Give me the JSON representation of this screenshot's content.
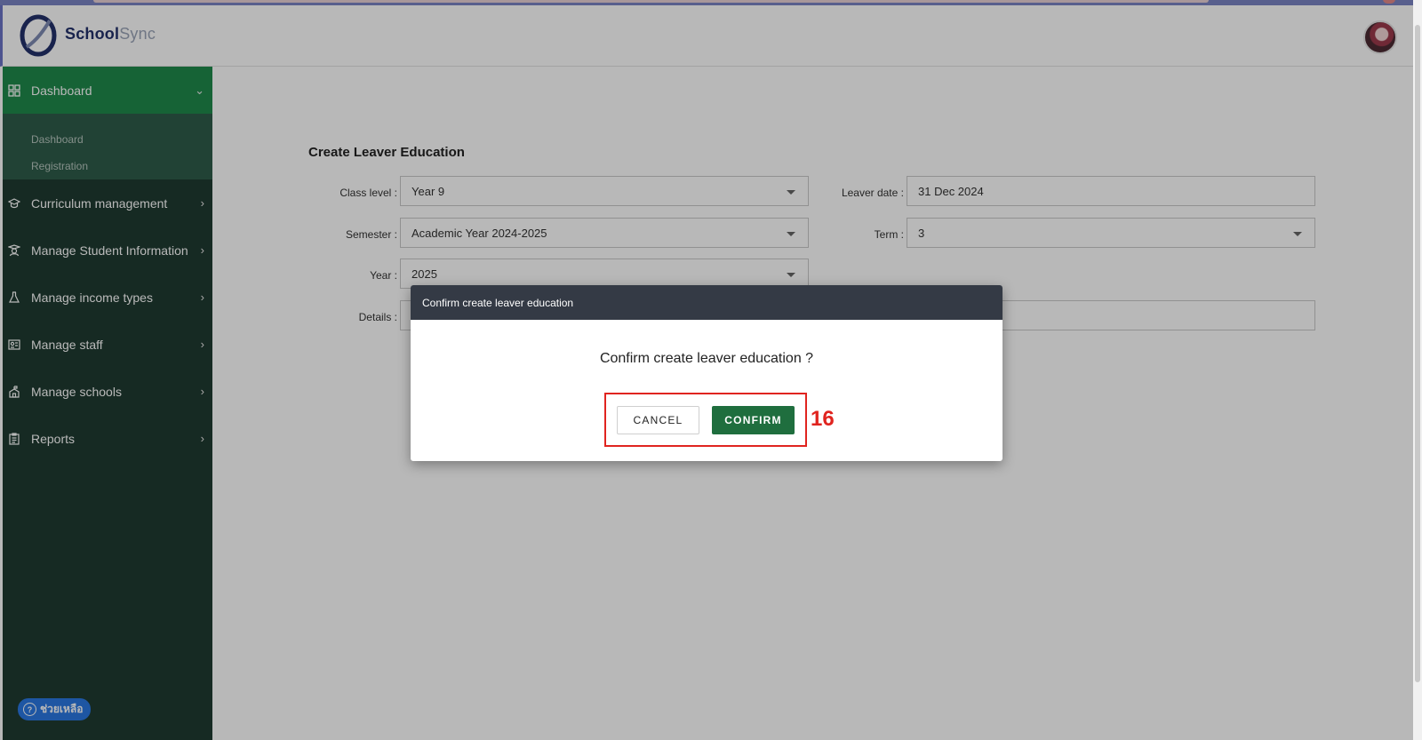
{
  "app": {
    "name_part1": "School",
    "name_part2": "Sync"
  },
  "sidebar": {
    "items": [
      {
        "label": "Dashboard",
        "icon": "grid-icon",
        "expanded": true
      },
      {
        "label": "Curriculum management",
        "icon": "graduation-cap-icon"
      },
      {
        "label": "Manage Student Information",
        "icon": "student-icon"
      },
      {
        "label": "Manage income types",
        "icon": "flask-icon"
      },
      {
        "label": "Manage staff",
        "icon": "id-card-icon"
      },
      {
        "label": "Manage schools",
        "icon": "school-icon"
      },
      {
        "label": "Reports",
        "icon": "clipboard-icon"
      }
    ],
    "dashboard_sub": [
      "Dashboard",
      "Registration"
    ],
    "help_label": "ช่วยเหลือ"
  },
  "form": {
    "title": "Create Leaver Education",
    "class_level_label": "Class level :",
    "class_level_value": "Year 9",
    "semester_label": "Semester :",
    "semester_value": "Academic Year 2024-2025",
    "year_label": "Year :",
    "year_value": "2025",
    "details_label": "Details :",
    "details_value": "",
    "leaver_date_label": "Leaver date :",
    "leaver_date_value": "31 Dec 2024",
    "term_label": "Term :",
    "term_value": "3"
  },
  "modal": {
    "title": "Confirm create leaver education",
    "message": "Confirm create leaver education ?",
    "cancel_label": "CANCEL",
    "confirm_label": "CONFIRM"
  },
  "annotation": {
    "step_number": "16"
  },
  "colors": {
    "sidebar_bg": "#1f3b31",
    "sidebar_active": "#1f8a4c",
    "confirm_button": "#1f6e3e",
    "modal_header": "#343a45",
    "annotation_red": "#e0241f"
  }
}
